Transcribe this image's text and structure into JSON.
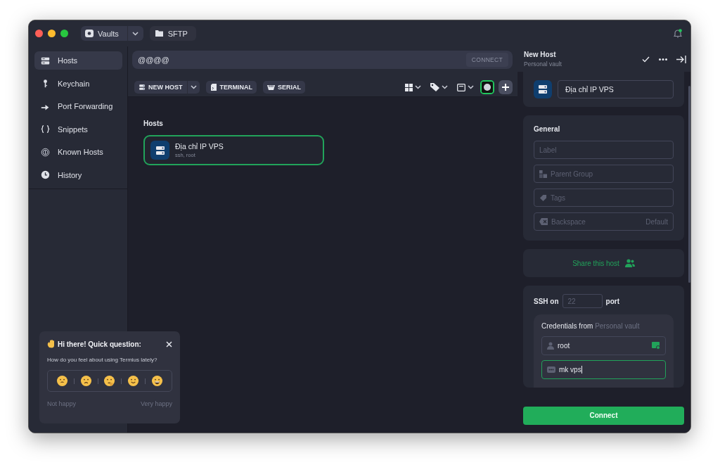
{
  "window": {
    "vault_button": "Vaults",
    "sftp_tab": "SFTP",
    "notification": true
  },
  "sidebar": {
    "items": [
      {
        "label": "Hosts",
        "selected": true
      },
      {
        "label": "Keychain",
        "selected": false
      },
      {
        "label": "Port Forwarding",
        "selected": false
      },
      {
        "label": "Snippets",
        "selected": false
      },
      {
        "label": "Known Hosts",
        "selected": false
      },
      {
        "label": "History",
        "selected": false
      }
    ]
  },
  "search": {
    "value": "@@@@",
    "connect_button": "CONNECT",
    "connect_disabled": true
  },
  "toolbar": {
    "buttons": [
      {
        "label": "NEW HOST",
        "dropdown": true
      },
      {
        "label": "TERMINAL",
        "dropdown": false
      },
      {
        "label": "SERIAL",
        "dropdown": false
      }
    ]
  },
  "hosts": {
    "heading": "Hosts",
    "items": [
      {
        "name": "Địa chỉ IP VPS",
        "detail": "ssh, root",
        "selected": true
      }
    ]
  },
  "survey": {
    "title": "Hi there! Quick question:",
    "question": "How do you feel about using Termius lately?",
    "ratings": [
      {
        "kind": "tired"
      },
      {
        "kind": "frown"
      },
      {
        "kind": "thinking"
      },
      {
        "kind": "smile"
      },
      {
        "kind": "grin"
      }
    ],
    "low_label": "Not happy",
    "high_label": "Very happy"
  },
  "panel": {
    "title": "New Host",
    "subtitle": "Personal vault",
    "address_value": "Địa chỉ IP VPS",
    "general": {
      "heading": "General",
      "fields": [
        {
          "kind": "plain",
          "placeholder": "Label"
        },
        {
          "kind": "group",
          "placeholder": "Parent Group"
        },
        {
          "kind": "tag",
          "placeholder": "Tags"
        },
        {
          "kind": "backspace",
          "placeholder": "Backspace",
          "hint": "Default"
        }
      ]
    },
    "share": "Share this host",
    "ssh": {
      "label_before": "SSH on",
      "port_placeholder": "22",
      "label_after": "port",
      "credentials": {
        "label": "Credentials from",
        "source": "Personal vault",
        "fields": [
          {
            "kind": "user",
            "value": "root",
            "focused": false
          },
          {
            "kind": "password",
            "value": "mk vps",
            "focused": true
          }
        ]
      }
    },
    "connect": "Connect"
  }
}
